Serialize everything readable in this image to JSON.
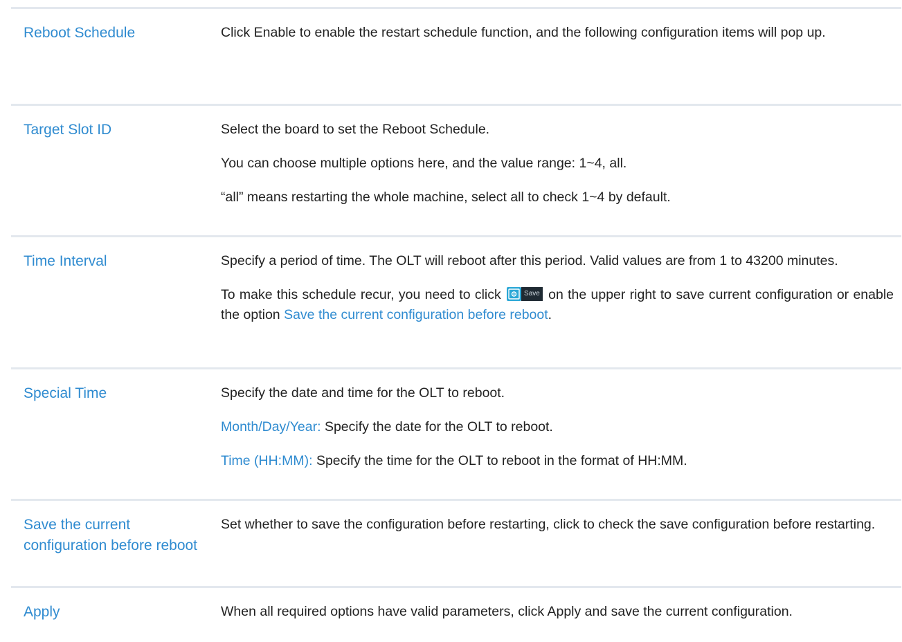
{
  "rows": [
    {
      "term": "Reboot Schedule",
      "desc": [
        "Click Enable to enable the restart schedule function, and the following configuration items will pop up."
      ]
    },
    {
      "term": "Target Slot ID",
      "desc": [
        "Select the board to set the Reboot Schedule.",
        "You can choose multiple options here, and the value range: 1~4, all.",
        "“all” means restarting the whole machine, select all to check 1~4 by default."
      ]
    },
    {
      "term": "Time Interval",
      "desc_p1": "Specify a period of time. The OLT will reboot after this period. Valid values are from 1 to 43200 minutes.",
      "desc_p2_before": "To make this schedule recur, you need to click",
      "save_icon_label": "Save",
      "desc_p2_middle": "on the upper right to save current configuration or enable the option",
      "desc_p2_link": "Save the current configuration before reboot",
      "desc_p2_after": "."
    },
    {
      "term": "Special Time",
      "desc_p1": "Specify the date and time for the OLT to reboot.",
      "date_label": "Month/Day/Year:",
      "date_text": "Specify the date for the OLT to reboot.",
      "time_label": "Time (HH:MM):",
      "time_text": "Specify the time for the OLT to reboot in the format of HH:MM."
    },
    {
      "term": "Save the current configuration before reboot",
      "desc": [
        "Set whether to save the configuration before restarting, click to check the save configuration before restarting."
      ]
    },
    {
      "term": "Apply",
      "desc": [
        "When all required options have valid parameters, click Apply and save the current configuration."
      ]
    }
  ],
  "colors": {
    "accent": "#2f8bd0",
    "divider": "#e3e8ee",
    "text": "#222222"
  },
  "icons": {
    "save": "save-config-icon"
  }
}
